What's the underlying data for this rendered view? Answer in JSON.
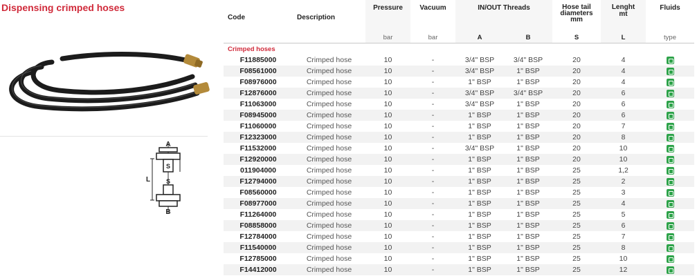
{
  "section_title": "Dispensing crimped hoses",
  "table": {
    "headers": {
      "code": "Code",
      "description": "Description",
      "pressure": "Pressure",
      "vacuum": "Vacuum",
      "threads": "IN/OUT Threads",
      "hose_tail_l1": "Hose tail",
      "hose_tail_l2": "diameters",
      "hose_tail_l3": "mm",
      "length_l1": "Lenght",
      "length_l2": "mt",
      "fluids": "Fluids"
    },
    "units": {
      "pressure": "bar",
      "vacuum": "bar",
      "thread_a": "A",
      "thread_b": "B",
      "hose_tail": "S",
      "length": "L",
      "fluids": "type"
    },
    "group_label": "Crimped hoses",
    "rows": [
      {
        "code": "F11885000",
        "desc": "Crimped hose",
        "pressure": "10",
        "vacuum": "-",
        "a": "3/4\" BSP",
        "b": "3/4\" BSP",
        "s": "20",
        "l": "4"
      },
      {
        "code": "F08561000",
        "desc": "Crimped hose",
        "pressure": "10",
        "vacuum": "-",
        "a": "3/4\" BSP",
        "b": "1\" BSP",
        "s": "20",
        "l": "4"
      },
      {
        "code": "F08976000",
        "desc": "Crimped hose",
        "pressure": "10",
        "vacuum": "-",
        "a": "1\" BSP",
        "b": "1\" BSP",
        "s": "20",
        "l": "4"
      },
      {
        "code": "F12876000",
        "desc": "Crimped hose",
        "pressure": "10",
        "vacuum": "-",
        "a": "3/4\" BSP",
        "b": "3/4\" BSP",
        "s": "20",
        "l": "6"
      },
      {
        "code": "F11063000",
        "desc": "Crimped hose",
        "pressure": "10",
        "vacuum": "-",
        "a": "3/4\" BSP",
        "b": "1\" BSP",
        "s": "20",
        "l": "6"
      },
      {
        "code": "F08945000",
        "desc": "Crimped hose",
        "pressure": "10",
        "vacuum": "-",
        "a": "1\" BSP",
        "b": "1\" BSP",
        "s": "20",
        "l": "6"
      },
      {
        "code": "F11060000",
        "desc": "Crimped hose",
        "pressure": "10",
        "vacuum": "-",
        "a": "1\" BSP",
        "b": "1\" BSP",
        "s": "20",
        "l": "7"
      },
      {
        "code": "F12323000",
        "desc": "Crimped hose",
        "pressure": "10",
        "vacuum": "-",
        "a": "1\" BSP",
        "b": "1\" BSP",
        "s": "20",
        "l": "8"
      },
      {
        "code": "F11532000",
        "desc": "Crimped hose",
        "pressure": "10",
        "vacuum": "-",
        "a": "3/4\" BSP",
        "b": "1\" BSP",
        "s": "20",
        "l": "10"
      },
      {
        "code": "F12920000",
        "desc": "Crimped hose",
        "pressure": "10",
        "vacuum": "-",
        "a": "1\" BSP",
        "b": "1\" BSP",
        "s": "20",
        "l": "10"
      },
      {
        "code": "011904000",
        "desc": "Crimped hose",
        "pressure": "10",
        "vacuum": "-",
        "a": "1\" BSP",
        "b": "1\" BSP",
        "s": "25",
        "l": "1,2"
      },
      {
        "code": "F12794000",
        "desc": "Crimped hose",
        "pressure": "10",
        "vacuum": "-",
        "a": "1\" BSP",
        "b": "1\" BSP",
        "s": "25",
        "l": "2"
      },
      {
        "code": "F08560000",
        "desc": "Crimped hose",
        "pressure": "10",
        "vacuum": "-",
        "a": "1\" BSP",
        "b": "1\" BSP",
        "s": "25",
        "l": "3"
      },
      {
        "code": "F08977000",
        "desc": "Crimped hose",
        "pressure": "10",
        "vacuum": "-",
        "a": "1\" BSP",
        "b": "1\" BSP",
        "s": "25",
        "l": "4"
      },
      {
        "code": "F11264000",
        "desc": "Crimped hose",
        "pressure": "10",
        "vacuum": "-",
        "a": "1\" BSP",
        "b": "1\" BSP",
        "s": "25",
        "l": "5"
      },
      {
        "code": "F08858000",
        "desc": "Crimped hose",
        "pressure": "10",
        "vacuum": "-",
        "a": "1\" BSP",
        "b": "1\" BSP",
        "s": "25",
        "l": "6"
      },
      {
        "code": "F12784000",
        "desc": "Crimped hose",
        "pressure": "10",
        "vacuum": "-",
        "a": "1\" BSP",
        "b": "1\" BSP",
        "s": "25",
        "l": "7"
      },
      {
        "code": "F11540000",
        "desc": "Crimped hose",
        "pressure": "10",
        "vacuum": "-",
        "a": "1\" BSP",
        "b": "1\" BSP",
        "s": "25",
        "l": "8"
      },
      {
        "code": "F12785000",
        "desc": "Crimped hose",
        "pressure": "10",
        "vacuum": "-",
        "a": "1\" BSP",
        "b": "1\" BSP",
        "s": "25",
        "l": "10"
      },
      {
        "code": "F14412000",
        "desc": "Crimped hose",
        "pressure": "10",
        "vacuum": "-",
        "a": "1\" BSP",
        "b": "1\" BSP",
        "s": "25",
        "l": "12"
      }
    ],
    "fluid_icon": "fluid-type-d-icon"
  },
  "diagram": {
    "label_a": "A",
    "label_s_top": "S",
    "label_l": "L",
    "label_s_bottom": "S",
    "label_b": "B"
  },
  "colors": {
    "brand_red": "#d02a3a",
    "fluid_green": "#2ea34a"
  }
}
